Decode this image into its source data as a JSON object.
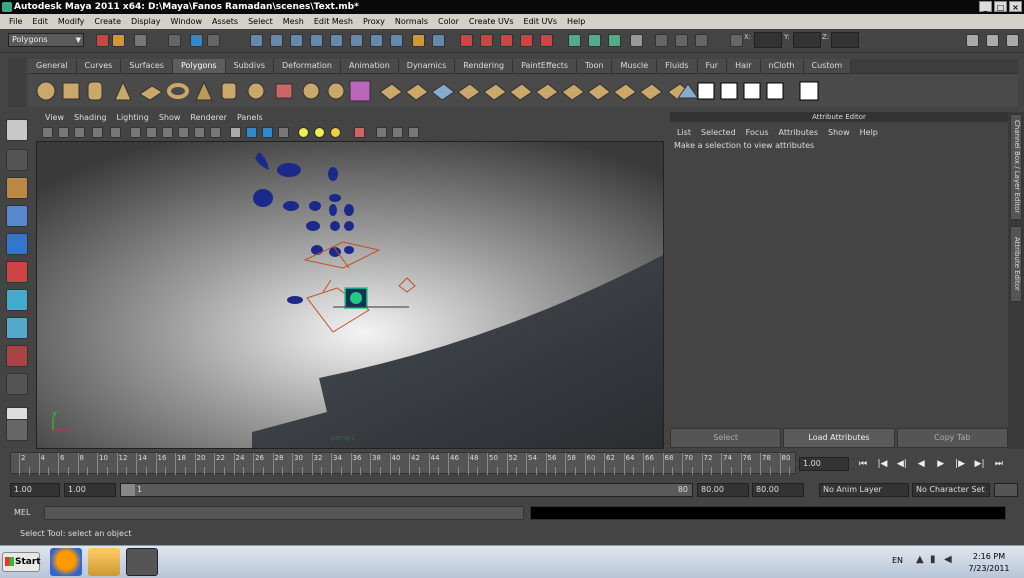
{
  "window": {
    "title": "Autodesk Maya 2011 x64: D:\\Maya\\Fanos Ramadan\\scenes\\Text.mb*"
  },
  "menubar": [
    "File",
    "Edit",
    "Modify",
    "Create",
    "Display",
    "Window",
    "Assets",
    "Select",
    "Mesh",
    "Edit Mesh",
    "Proxy",
    "Normals",
    "Color",
    "Create UVs",
    "Edit UVs",
    "Help"
  ],
  "statusline": {
    "mode": "Polygons",
    "x_label": "X:",
    "y_label": "Y:",
    "z_label": "Z:"
  },
  "shelf": {
    "tabs": [
      "General",
      "Curves",
      "Surfaces",
      "Polygons",
      "Subdivs",
      "Deformation",
      "Animation",
      "Dynamics",
      "Rendering",
      "PaintEffects",
      "Toon",
      "Muscle",
      "Fluids",
      "Fur",
      "Hair",
      "nCloth",
      "Custom"
    ],
    "active": "Polygons"
  },
  "panel": {
    "menu": [
      "View",
      "Shading",
      "Lighting",
      "Show",
      "Renderer",
      "Panels"
    ],
    "camera_label": "persp1",
    "axis_y": "y",
    "axis_x": "x"
  },
  "attribute_editor": {
    "title": "Attribute Editor",
    "menu": [
      "List",
      "Selected",
      "Focus",
      "Attributes",
      "Show",
      "Help"
    ],
    "message": "Make a selection to view attributes",
    "buttons": {
      "select": "Select",
      "load": "Load Attributes",
      "copy": "Copy Tab"
    }
  },
  "side_tabs": {
    "channel": "Channel Box / Layer Editor",
    "attribute": "Attribute Editor"
  },
  "timeline": {
    "ticks": [
      "2",
      "4",
      "6",
      "8",
      "10",
      "12",
      "14",
      "16",
      "18",
      "20",
      "22",
      "24",
      "26",
      "28",
      "30",
      "32",
      "34",
      "36",
      "38",
      "40",
      "42",
      "44",
      "46",
      "48",
      "50",
      "52",
      "54",
      "56",
      "58",
      "60",
      "62",
      "64",
      "66",
      "68",
      "70",
      "72",
      "74",
      "76",
      "78",
      "80"
    ],
    "current_frame": "1.00"
  },
  "range": {
    "start": "1.00",
    "anim_start": "1.00",
    "slider_start": "1",
    "slider_end": "80",
    "anim_end": "80.00",
    "end": "80.00",
    "anim_layer": "No Anim Layer",
    "char_set": "No Character Set"
  },
  "command": {
    "label": "MEL"
  },
  "help": {
    "text": "Select Tool: select an object"
  },
  "taskbar": {
    "start": "Start",
    "lang": "EN",
    "time": "2:16 PM",
    "date": "7/23/2011"
  }
}
